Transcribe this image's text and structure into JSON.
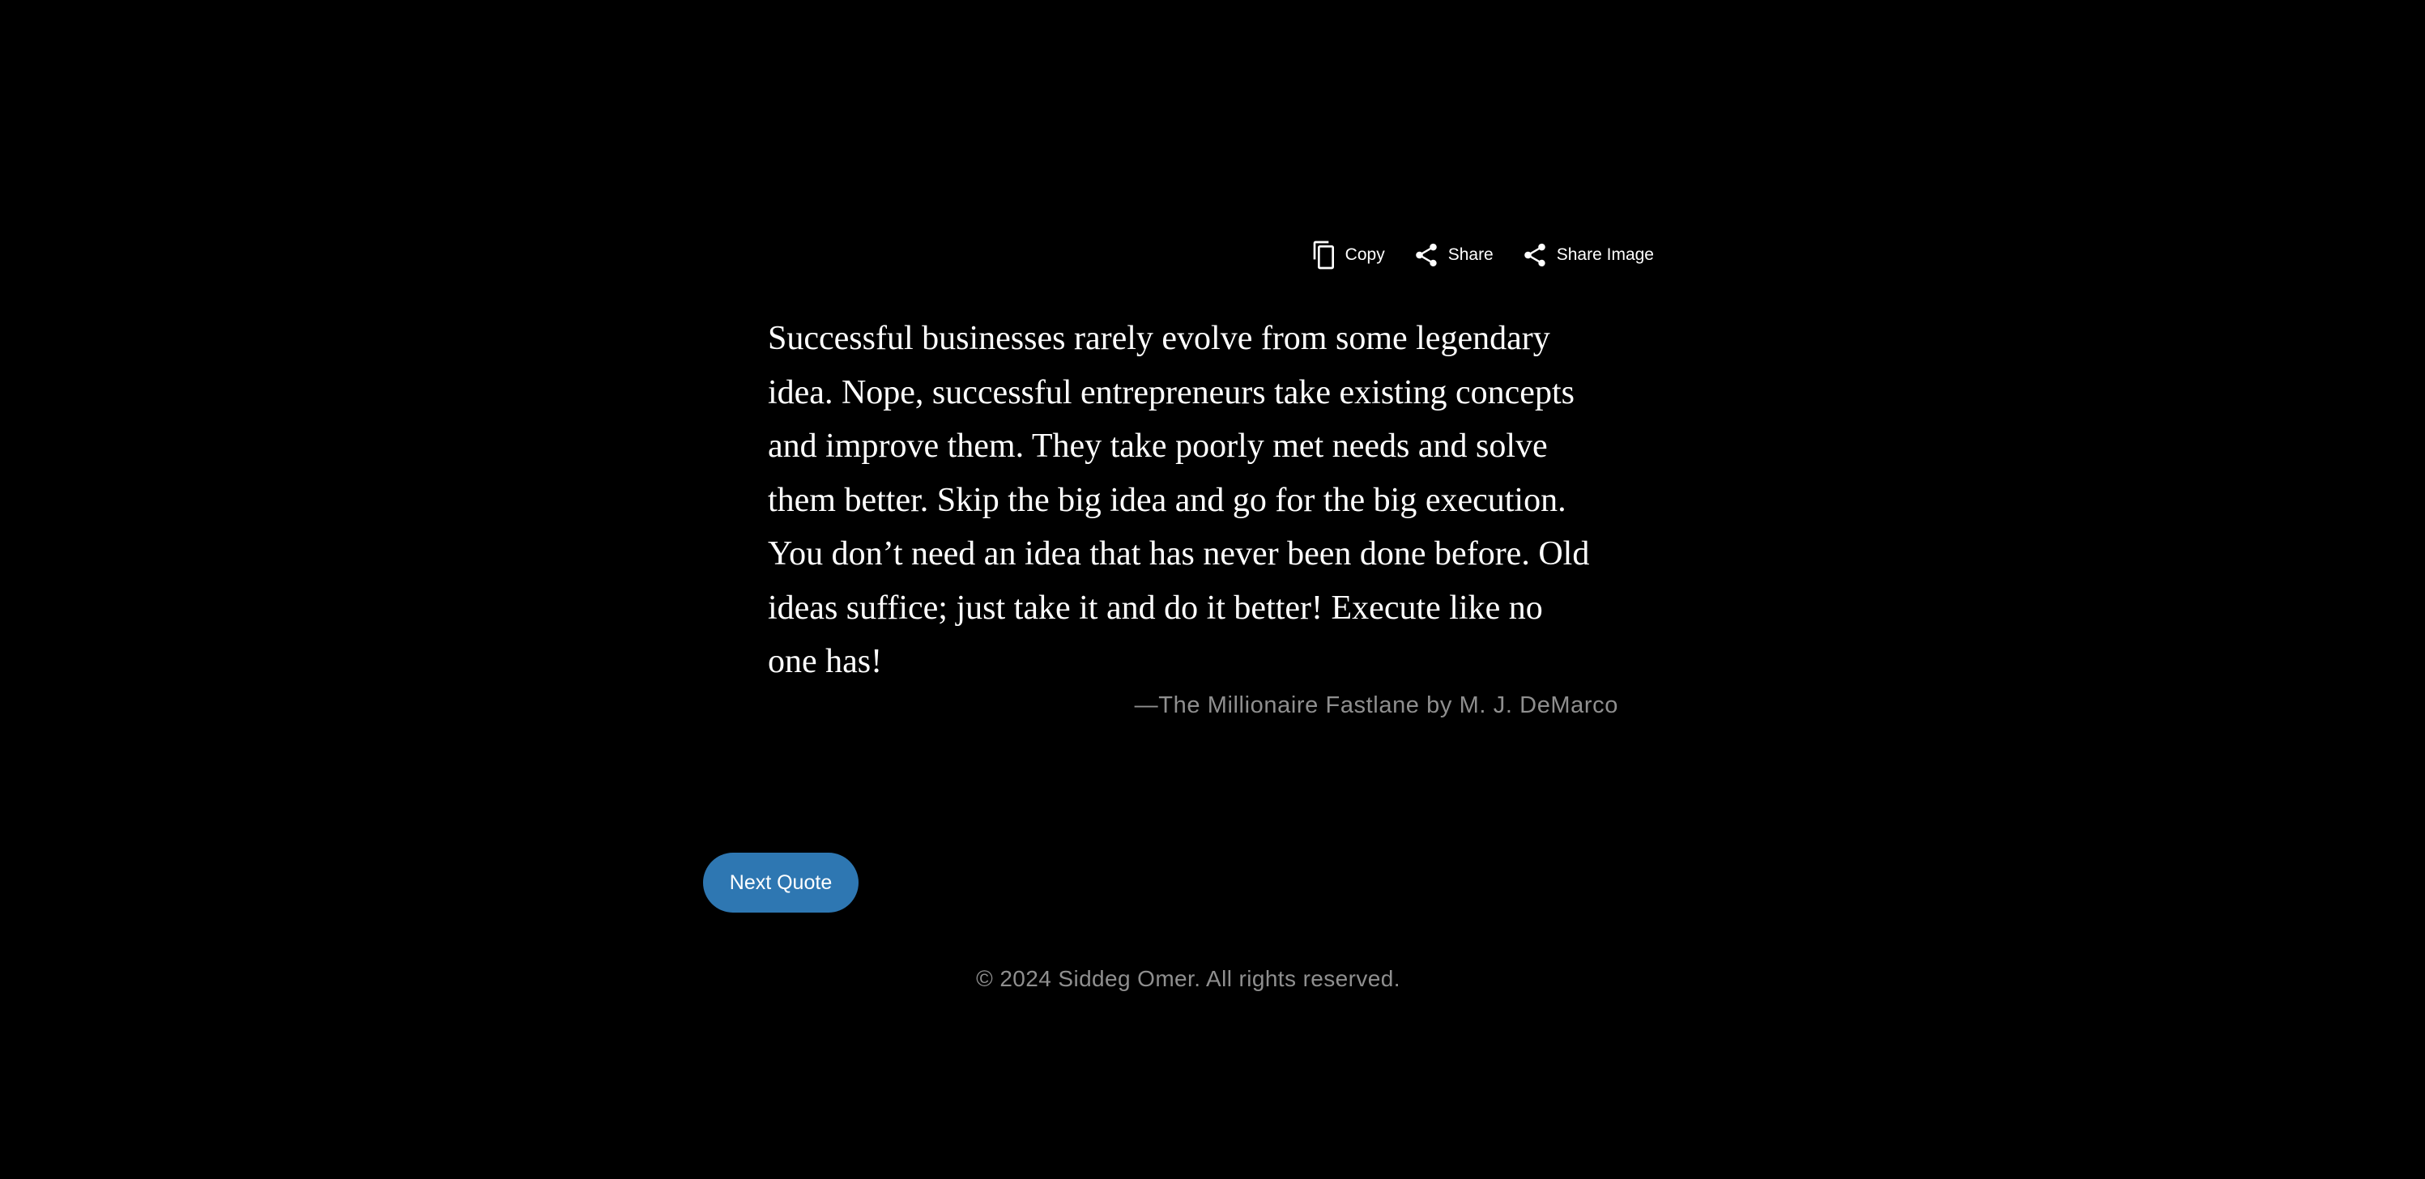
{
  "toolbar": {
    "copy": {
      "label": "Copy",
      "icon": "copy-icon"
    },
    "share": {
      "label": "Share",
      "icon": "share-icon"
    },
    "share_image": {
      "label": "Share Image",
      "icon": "share-icon"
    }
  },
  "quote": {
    "lines": [
      "Successful businesses rarely evolve from some legendary",
      "idea. Nope, successful entrepreneurs take existing concepts",
      "and improve them. They take poorly met needs and solve",
      "them better. Skip the big idea and go for the big execution.",
      "You don’t need an idea that has never been done before. Old",
      "ideas suffice; just take it and do it better! Execute like no",
      "one has!"
    ],
    "attribution": "—The Millionaire Fastlane by M. J. DeMarco"
  },
  "actions": {
    "next_label": "Next Quote"
  },
  "footer": {
    "text": "© 2024 Siddeg Omer. All rights reserved."
  },
  "colors": {
    "background": "#000000",
    "accent": "#2e77b2",
    "muted_text": "#8f8f8f",
    "text": "#ffffff"
  }
}
